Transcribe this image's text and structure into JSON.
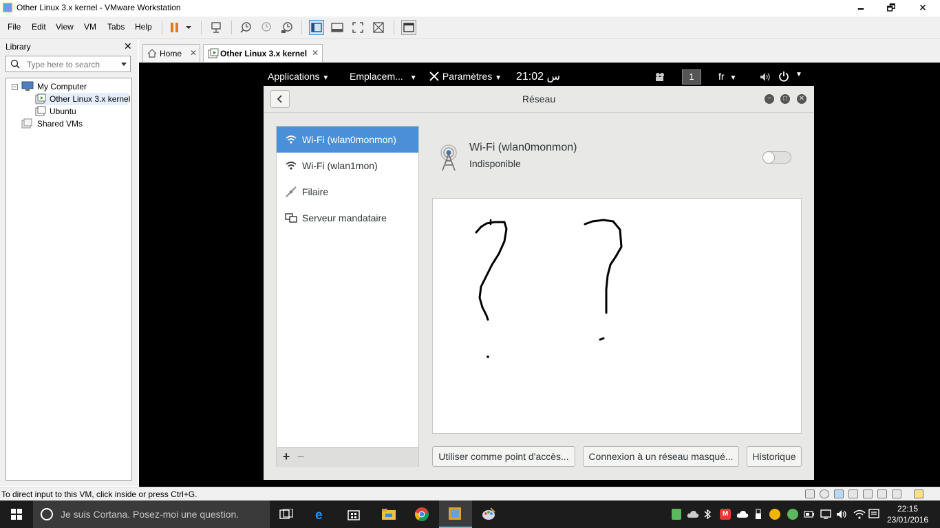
{
  "window": {
    "title": "Other Linux 3.x kernel - VMware Workstation",
    "minimize_glyph": "🗕",
    "maximize_glyph": "🗗",
    "close_glyph": "✕"
  },
  "menubar": {
    "items": [
      "File",
      "Edit",
      "View",
      "VM",
      "Tabs",
      "Help"
    ]
  },
  "library": {
    "header": "Library",
    "close_glyph": "✕",
    "search_placeholder": "Type here to search",
    "tree": {
      "root": "My Computer",
      "children": [
        "Other Linux 3.x kernel",
        "Ubuntu"
      ],
      "shared": "Shared VMs"
    }
  },
  "tabs": [
    {
      "label": "Home",
      "close": "✕"
    },
    {
      "label": "Other Linux 3.x kernel",
      "close": "✕"
    }
  ],
  "gnome_bar": {
    "applications": "Applications",
    "places": "Emplacem...",
    "settings": "Paramètres",
    "clock": "21:02 س",
    "workspace": "1",
    "language": "fr"
  },
  "reseau": {
    "title": "Réseau",
    "networks": [
      {
        "label": "Wi-Fi (wlan0monmon)",
        "icon": "wifi-icon",
        "selected": true
      },
      {
        "label": "Wi-Fi (wlan1mon)",
        "icon": "wifi-icon",
        "selected": false
      },
      {
        "label": "Filaire",
        "icon": "wired-icon",
        "selected": false
      },
      {
        "label": "Serveur mandataire",
        "icon": "proxy-icon",
        "selected": false
      }
    ],
    "add_glyph": "+",
    "remove_glyph": "−",
    "detail_title": "Wi-Fi (wlan0monmon)",
    "detail_status": "Indisponible",
    "switch_on": false,
    "buttons": {
      "hotspot": "Utiliser comme point d'accès...",
      "hidden": "Connexion à un réseau masqué...",
      "history": "Historique"
    }
  },
  "statusbar": {
    "message": "To direct input to this VM, click inside or press Ctrl+G."
  },
  "taskbar": {
    "cortana_text": "Je suis Cortana. Posez-moi une question.",
    "time": "22:15",
    "date": "23/01/2016"
  }
}
